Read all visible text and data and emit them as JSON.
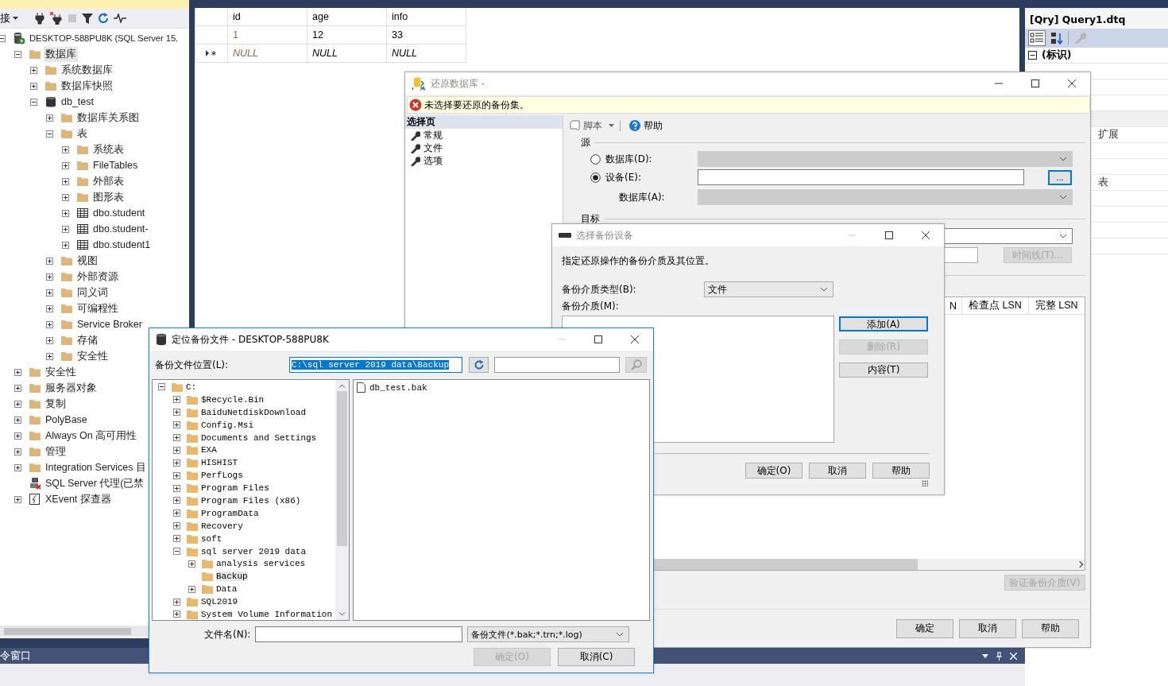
{
  "object_explorer": {
    "connect_label": "接",
    "tree": [
      {
        "label": "DESKTOP-588PU8K (SQL Server 15.",
        "kind": "server",
        "expanded": true,
        "selected": false,
        "children": [
          {
            "label": "数据库",
            "kind": "folder",
            "expanded": true,
            "selected": true,
            "children": [
              {
                "label": "系统数据库",
                "kind": "folder",
                "expanded": false,
                "selected": false
              },
              {
                "label": "数据库快照",
                "kind": "folder",
                "expanded": false,
                "selected": false
              },
              {
                "label": "db_test",
                "kind": "database",
                "expanded": true,
                "selected": false,
                "children": [
                  {
                    "label": "数据库关系图",
                    "kind": "folder",
                    "expanded": false,
                    "selected": false
                  },
                  {
                    "label": "表",
                    "kind": "folder",
                    "expanded": true,
                    "selected": false,
                    "children": [
                      {
                        "label": "系统表",
                        "kind": "folder",
                        "expanded": false,
                        "selected": false
                      },
                      {
                        "label": "FileTables",
                        "kind": "folder",
                        "expanded": false,
                        "selected": false
                      },
                      {
                        "label": "外部表",
                        "kind": "folder",
                        "expanded": false,
                        "selected": false
                      },
                      {
                        "label": "图形表",
                        "kind": "folder",
                        "expanded": false,
                        "selected": false
                      },
                      {
                        "label": "dbo.student",
                        "kind": "table",
                        "expanded": false,
                        "selected": false
                      },
                      {
                        "label": "dbo.student-",
                        "kind": "table",
                        "expanded": false,
                        "selected": false
                      },
                      {
                        "label": "dbo.student1",
                        "kind": "table",
                        "expanded": false,
                        "selected": false
                      }
                    ]
                  },
                  {
                    "label": "视图",
                    "kind": "folder",
                    "expanded": false,
                    "selected": false
                  },
                  {
                    "label": "外部资源",
                    "kind": "folder",
                    "expanded": false,
                    "selected": false
                  },
                  {
                    "label": "同义词",
                    "kind": "folder",
                    "expanded": false,
                    "selected": false
                  },
                  {
                    "label": "可编程性",
                    "kind": "folder",
                    "expanded": false,
                    "selected": false
                  },
                  {
                    "label": "Service Broker",
                    "kind": "folder",
                    "expanded": false,
                    "selected": false
                  },
                  {
                    "label": "存储",
                    "kind": "folder",
                    "expanded": false,
                    "selected": false
                  },
                  {
                    "label": "安全性",
                    "kind": "folder",
                    "expanded": false,
                    "selected": false
                  }
                ]
              }
            ]
          },
          {
            "label": "安全性",
            "kind": "folder",
            "expanded": false,
            "selected": false
          },
          {
            "label": "服务器对象",
            "kind": "folder",
            "expanded": false,
            "selected": false
          },
          {
            "label": "复制",
            "kind": "folder",
            "expanded": false,
            "selected": false
          },
          {
            "label": "PolyBase",
            "kind": "folder",
            "expanded": false,
            "selected": false
          },
          {
            "label": "Always On 高可用性",
            "kind": "folder",
            "expanded": false,
            "selected": false
          },
          {
            "label": "管理",
            "kind": "folder",
            "expanded": false,
            "selected": false
          },
          {
            "label": "Integration Services 目",
            "kind": "folder",
            "expanded": false,
            "selected": false
          },
          {
            "label": "SQL Server 代理(已禁",
            "kind": "agent",
            "selected": false
          },
          {
            "label": "XEvent 探查器",
            "kind": "xevent",
            "expanded": false,
            "selected": false
          }
        ]
      }
    ]
  },
  "results": {
    "columns": [
      "id",
      "age",
      "info"
    ],
    "rows": [
      {
        "cells": [
          "1",
          "12",
          "33"
        ],
        "new_row": false
      },
      {
        "cells": [
          "NULL",
          "NULL",
          "NULL"
        ],
        "new_row": true
      }
    ]
  },
  "properties": {
    "object": "[Qry] Query1.dtq",
    "rows": [
      {
        "kind": "category",
        "label": "(标识)",
        "expanded": true
      },
      {
        "kind": "property"
      },
      {
        "kind": "property"
      },
      {
        "kind": "property"
      },
      {
        "kind": "category"
      },
      {
        "kind": "property",
        "value": "扩展"
      },
      {
        "kind": "property"
      },
      {
        "kind": "property"
      },
      {
        "kind": "property",
        "value": "表"
      },
      {
        "kind": "property"
      },
      {
        "kind": "property"
      },
      {
        "kind": "property"
      },
      {
        "kind": "property"
      }
    ]
  },
  "command_window": {
    "title": "令窗口"
  },
  "restore_dialog": {
    "title": "还原数据库 -",
    "message": "未选择要还原的备份集。",
    "pages_header": "选择页",
    "pages": [
      "常规",
      "文件",
      "选项"
    ],
    "script_label": "脚本",
    "help_label": "帮助",
    "source_label": "源",
    "source_options": [
      {
        "label": "数据库(D):",
        "selected": false
      },
      {
        "label": "设备(E):",
        "selected": true
      }
    ],
    "browse_button": "...",
    "database_label": "数据库(A):",
    "destination_label": "目标",
    "timeline_button": {
      "label": "时间线(T)...",
      "disabled": true
    },
    "backup_set_columns": [
      "N",
      "检查点 LSN",
      "完整 LSN"
    ],
    "verify_button": {
      "label": "验证备份介质(V)",
      "disabled": true
    },
    "buttons": [
      "确定",
      "取消",
      "帮助"
    ]
  },
  "device_dialog": {
    "title": "选择备份设备",
    "instruction": "指定还原操作的备份介质及其位置。",
    "media_type_label": "备份介质类型(B):",
    "media_type_value": "文件",
    "media_label": "备份介质(M):",
    "side_buttons": [
      {
        "label": "添加(A)",
        "disabled": false,
        "focused": true
      },
      {
        "label": "删除(R)",
        "disabled": true,
        "focused": false
      },
      {
        "label": "内容(T)",
        "disabled": false,
        "focused": false
      }
    ],
    "buttons": [
      "确定(O)",
      "取消",
      "帮助"
    ]
  },
  "locate_dialog": {
    "title": "定位备份文件 - DESKTOP-588PU8K",
    "location_label": "备份文件位置(L):",
    "location_value": "C:\\sql server 2019 data\\Backup",
    "folders": [
      {
        "label": "C:",
        "expanded": true,
        "selected": false,
        "children": [
          {
            "label": "$Recycle.Bin",
            "expanded": false,
            "selected": false
          },
          {
            "label": "BaiduNetdiskDownload",
            "expanded": false,
            "selected": false
          },
          {
            "label": "Config.Msi",
            "expanded": false,
            "selected": false
          },
          {
            "label": "Documents and Settings",
            "expanded": false,
            "selected": false
          },
          {
            "label": "EXA",
            "expanded": false,
            "selected": false
          },
          {
            "label": "HISHIST",
            "expanded": false,
            "selected": false
          },
          {
            "label": "PerfLogs",
            "expanded": false,
            "selected": false
          },
          {
            "label": "Program Files",
            "expanded": false,
            "selected": false
          },
          {
            "label": "Program Files (x86)",
            "expanded": false,
            "selected": false
          },
          {
            "label": "ProgramData",
            "expanded": false,
            "selected": false
          },
          {
            "label": "Recovery",
            "expanded": false,
            "selected": false
          },
          {
            "label": "soft",
            "expanded": false,
            "selected": false
          },
          {
            "label": "sql server 2019 data",
            "expanded": true,
            "selected": false,
            "children": [
              {
                "label": "analysis services",
                "expanded": false,
                "selected": false
              },
              {
                "label": "Backup",
                "selected": true
              },
              {
                "label": "Data",
                "expanded": false,
                "selected": false
              }
            ]
          },
          {
            "label": "SQL2019",
            "expanded": false,
            "selected": false
          },
          {
            "label": "System Volume Information",
            "expanded": false,
            "selected": false
          }
        ]
      }
    ],
    "files": [
      "db_test.bak"
    ],
    "file_name_label": "文件名(N):",
    "file_type_value": "备份文件(*.bak;*.trn;*.log)",
    "buttons": [
      {
        "label": "确定(O)",
        "disabled": true
      },
      {
        "label": "取消(C)",
        "disabled": false
      }
    ]
  }
}
